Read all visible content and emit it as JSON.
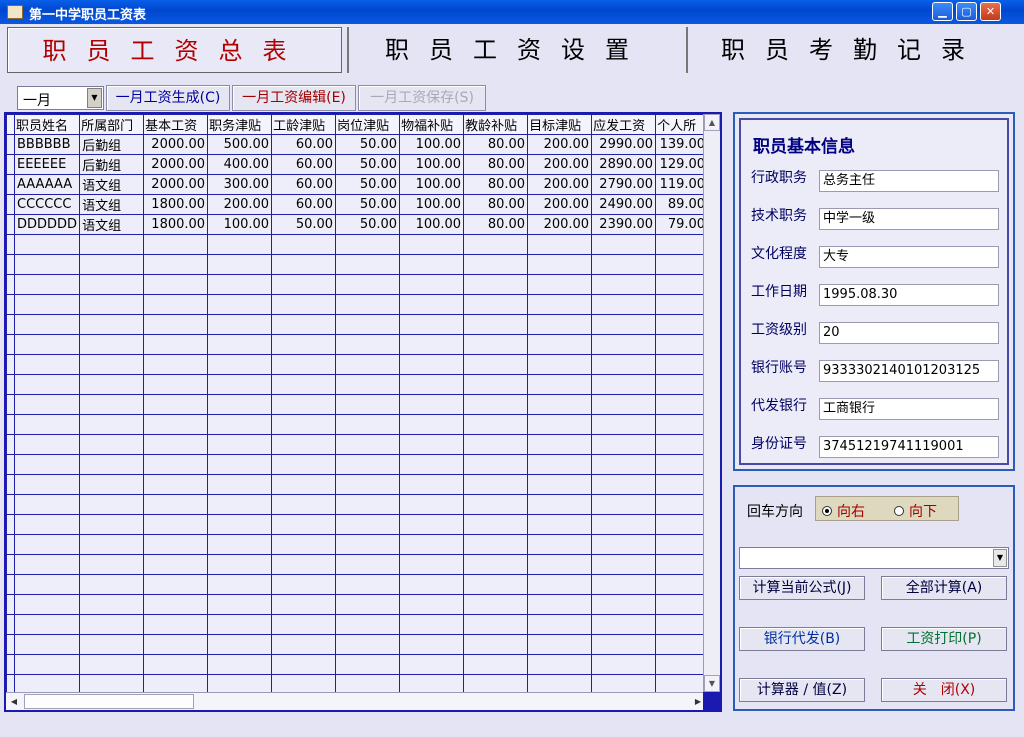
{
  "window": {
    "title": "第一中学职员工资表",
    "controls": [
      "0",
      "□",
      "X"
    ]
  },
  "tabs": [
    {
      "label": "职员工资总表",
      "active": true
    },
    {
      "label": "职员工资设置",
      "active": false
    },
    {
      "label": "职员考勤记录",
      "active": false
    }
  ],
  "toolbar": {
    "month": "一月",
    "generate": "一月工资生成(C)",
    "edit": "一月工资编辑(E)",
    "save": "一月工资保存(S)"
  },
  "grid": {
    "columns": [
      "职员姓名",
      "所属部门",
      "基本工资",
      "职务津贴",
      "工龄津贴",
      "岗位津贴",
      "物福补贴",
      "教龄补贴",
      "目标津贴",
      "应发工资",
      "个人所"
    ],
    "rows": [
      [
        "BBBBBB",
        "后勤组",
        "2000.00",
        "500.00",
        "60.00",
        "50.00",
        "100.00",
        "80.00",
        "200.00",
        "2990.00",
        "139.00"
      ],
      [
        "EEEEEE",
        "后勤组",
        "2000.00",
        "400.00",
        "60.00",
        "50.00",
        "100.00",
        "80.00",
        "200.00",
        "2890.00",
        "129.00"
      ],
      [
        "AAAAAA",
        "语文组",
        "2000.00",
        "300.00",
        "60.00",
        "50.00",
        "100.00",
        "80.00",
        "200.00",
        "2790.00",
        "119.00"
      ],
      [
        "CCCCCC",
        "语文组",
        "1800.00",
        "200.00",
        "60.00",
        "50.00",
        "100.00",
        "80.00",
        "200.00",
        "2490.00",
        "89.00"
      ],
      [
        "DDDDDD",
        "语文组",
        "1800.00",
        "100.00",
        "50.00",
        "50.00",
        "100.00",
        "80.00",
        "200.00",
        "2390.00",
        "79.00"
      ]
    ],
    "empty_rows": 23
  },
  "info": {
    "title": "职员基本信息",
    "fields": [
      {
        "label": "行政职务",
        "value": "总务主任"
      },
      {
        "label": "技术职务",
        "value": "中学一级"
      },
      {
        "label": "文化程度",
        "value": "大专"
      },
      {
        "label": "工作日期",
        "value": "1995.08.30"
      },
      {
        "label": "工资级别",
        "value": "20"
      },
      {
        "label": "银行账号",
        "value": "9333302140101203125"
      },
      {
        "label": "代发银行",
        "value": "工商银行"
      },
      {
        "label": "身份证号",
        "value": "37451219741119001"
      }
    ]
  },
  "controls": {
    "enter_direction_label": "回车方向",
    "radio_right": "向右",
    "radio_down": "向下",
    "formula_value": "",
    "calc_current": "计算当前公式(J)",
    "calc_all": "全部计算(A)",
    "bank": "银行代发(B)",
    "print": "工资打印(P)",
    "calculator": "计算器 / 值(Z)",
    "close": "关　闭(X)"
  }
}
